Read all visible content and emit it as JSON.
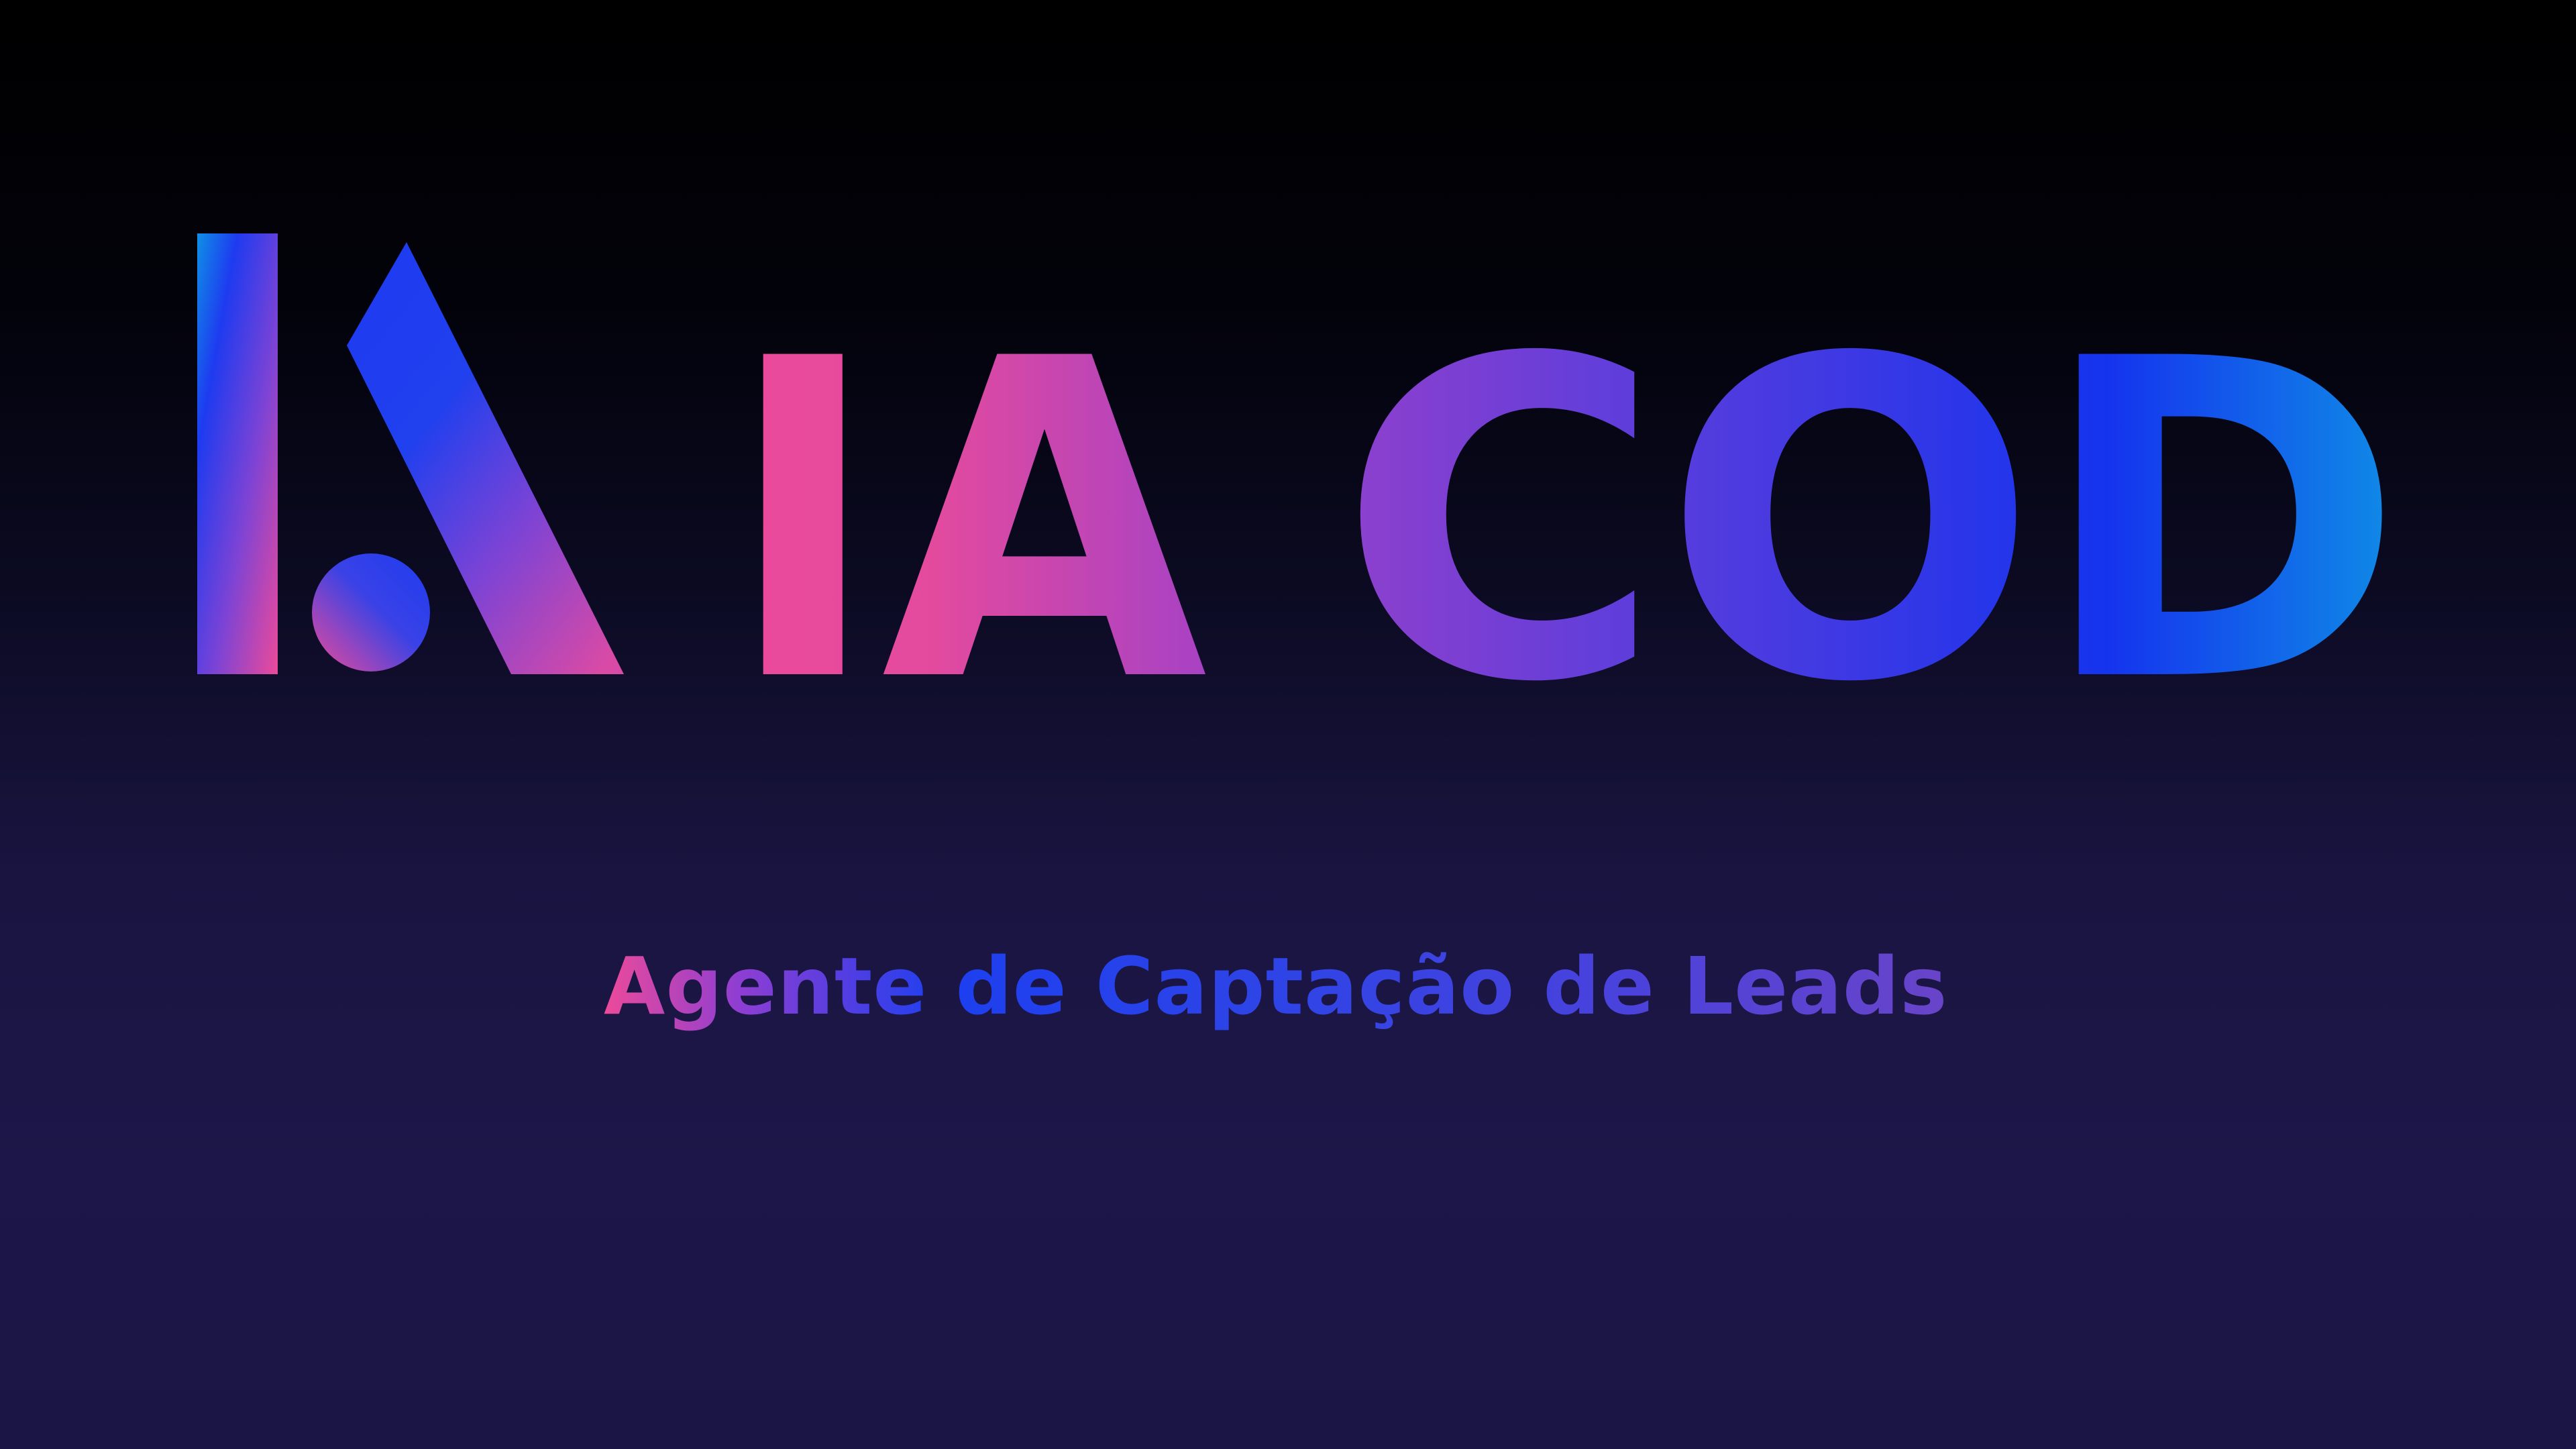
{
  "brand": {
    "name_part1": "IA",
    "name_part2": "COD",
    "tagline": "Agente de Captação de Leads",
    "logo": "ia-logo-mark"
  },
  "colors": {
    "pink": "#ec4a9a",
    "purple": "#8e3ed2",
    "blue": "#1e3bf0",
    "cyan": "#0f8fe6",
    "background_top": "#000000",
    "background_bottom": "#1d1749"
  }
}
